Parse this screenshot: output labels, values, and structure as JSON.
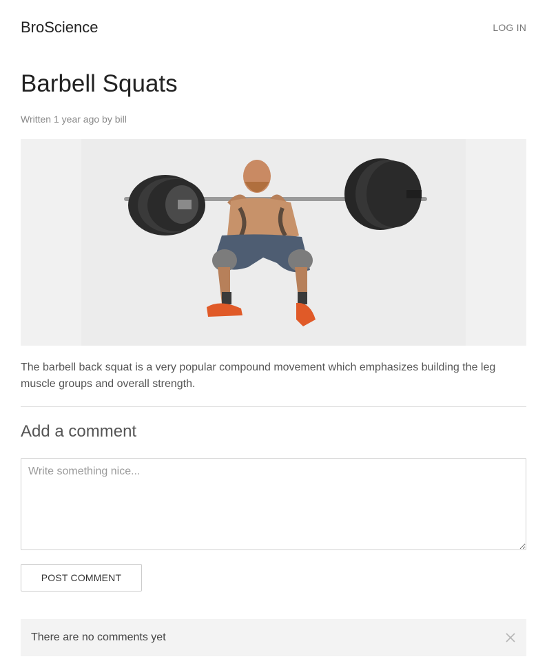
{
  "header": {
    "brand": "BroScience",
    "login_label": "LOG IN"
  },
  "article": {
    "title": "Barbell Squats",
    "meta": {
      "written_label": "Written",
      "time_ago": "1 year ago",
      "by_label": "by",
      "author": "bill"
    },
    "image_subject": "man performing barbell back squat",
    "body": "The barbell back squat is a very popular compound movement which emphasizes building the leg muscle groups and overall strength."
  },
  "comments": {
    "heading": "Add a comment",
    "input_placeholder": "Write something nice...",
    "input_value": "",
    "submit_label": "POST COMMENT",
    "empty_message": "There are no comments yet",
    "close_icon": "close-icon"
  },
  "colors": {
    "text": "#333333",
    "muted": "#888888",
    "notice_bg": "#f3f3f3",
    "hero_bg": "#f1f1f1"
  }
}
